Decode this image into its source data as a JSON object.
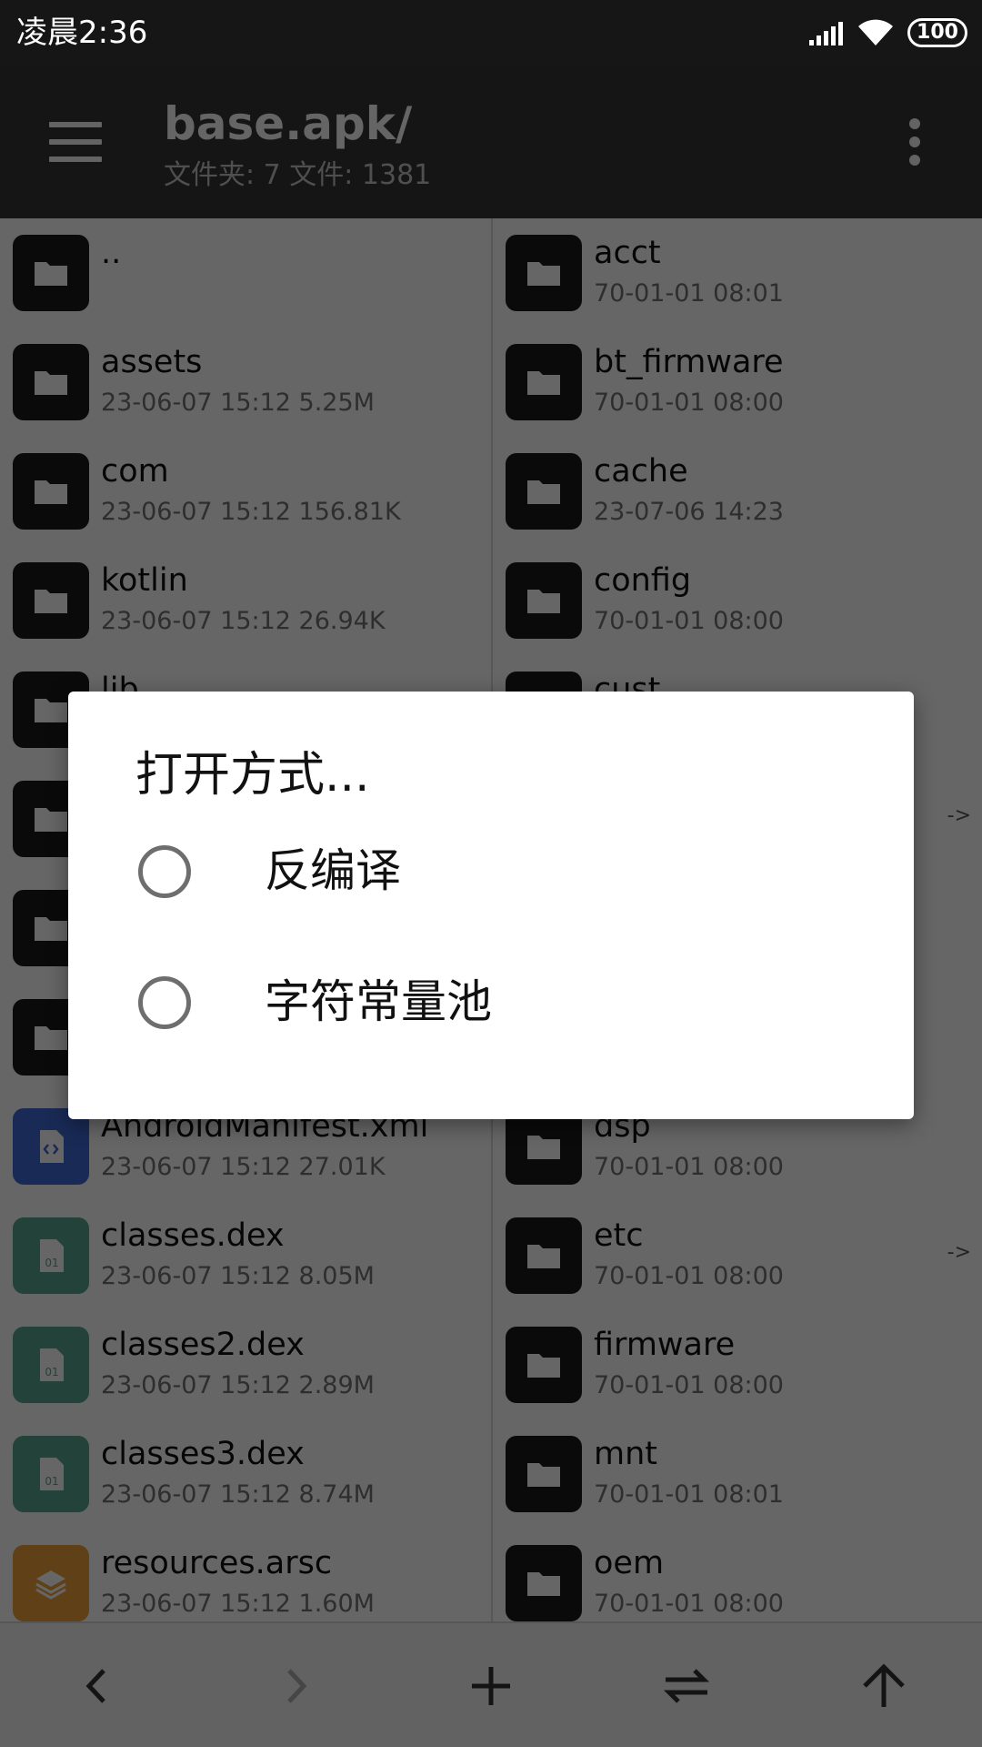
{
  "status_bar": {
    "time": "凌晨2:36",
    "battery": "100",
    "icons": [
      "signal-icon",
      "wifi-icon",
      "battery-icon"
    ]
  },
  "app_bar": {
    "title": "base.apk/",
    "subtitle": "文件夹: 7  文件: 1381",
    "icons": [
      "menu-icon",
      "more-vert-icon"
    ]
  },
  "left_pane": {
    "items": [
      {
        "name": "..",
        "meta": "",
        "icon": "folder-icon"
      },
      {
        "name": "assets",
        "meta": "23-06-07 15:12  5.25M",
        "icon": "folder-icon"
      },
      {
        "name": "com",
        "meta": "23-06-07 15:12  156.81K",
        "icon": "folder-icon"
      },
      {
        "name": "kotlin",
        "meta": "23-06-07 15:12  26.94K",
        "icon": "folder-icon"
      },
      {
        "name": "lib",
        "meta": "",
        "icon": "folder-icon"
      },
      {
        "name": "",
        "meta": "",
        "icon": "folder-icon"
      },
      {
        "name": "",
        "meta": "",
        "icon": "folder-icon"
      },
      {
        "name": "",
        "meta": "",
        "icon": "folder-icon"
      },
      {
        "name": "AndroidManifest.xml",
        "meta": "23-06-07 15:12  27.01K",
        "icon": "xml-file-icon"
      },
      {
        "name": "classes.dex",
        "meta": "23-06-07 15:12  8.05M",
        "icon": "dex-file-icon"
      },
      {
        "name": "classes2.dex",
        "meta": "23-06-07 15:12  2.89M",
        "icon": "dex-file-icon"
      },
      {
        "name": "classes3.dex",
        "meta": "23-06-07 15:12  8.74M",
        "icon": "dex-file-icon"
      },
      {
        "name": "resources.arsc",
        "meta": "23-06-07 15:12  1.60M",
        "icon": "layers-file-icon"
      }
    ]
  },
  "right_pane": {
    "items": [
      {
        "name": "acct",
        "meta": "70-01-01 08:01",
        "link": ""
      },
      {
        "name": "bt_firmware",
        "meta": "70-01-01 08:00",
        "link": ""
      },
      {
        "name": "cache",
        "meta": "23-07-06 14:23",
        "link": ""
      },
      {
        "name": "config",
        "meta": "70-01-01 08:00",
        "link": ""
      },
      {
        "name": "cust",
        "meta": "",
        "link": ""
      },
      {
        "name": "",
        "meta": "",
        "link": "->"
      },
      {
        "name": "",
        "meta": "",
        "link": ""
      },
      {
        "name": "",
        "meta": "",
        "link": ""
      },
      {
        "name": "dsp",
        "meta": "70-01-01 08:00",
        "link": ""
      },
      {
        "name": "etc",
        "meta": "70-01-01 08:00",
        "link": "->"
      },
      {
        "name": "firmware",
        "meta": "70-01-01 08:00",
        "link": ""
      },
      {
        "name": "mnt",
        "meta": "70-01-01 08:01",
        "link": ""
      },
      {
        "name": "oem",
        "meta": "70-01-01 08:00",
        "link": ""
      }
    ]
  },
  "bottom_bar": {
    "buttons": [
      "back-icon",
      "forward-icon",
      "add-icon",
      "swap-icon",
      "up-arrow-icon"
    ]
  },
  "dialog": {
    "title": "打开方式...",
    "options": [
      {
        "label": "反编译",
        "selected": false
      },
      {
        "label": "字符常量池",
        "selected": false
      }
    ]
  },
  "colors": {
    "folder_icon": "#1a1a1a",
    "xml_icon": "#3f6ad8",
    "dex_icon": "#58a592",
    "arsc_icon": "#f0a23b",
    "scrim": "rgba(0,0,0,0.6)"
  }
}
